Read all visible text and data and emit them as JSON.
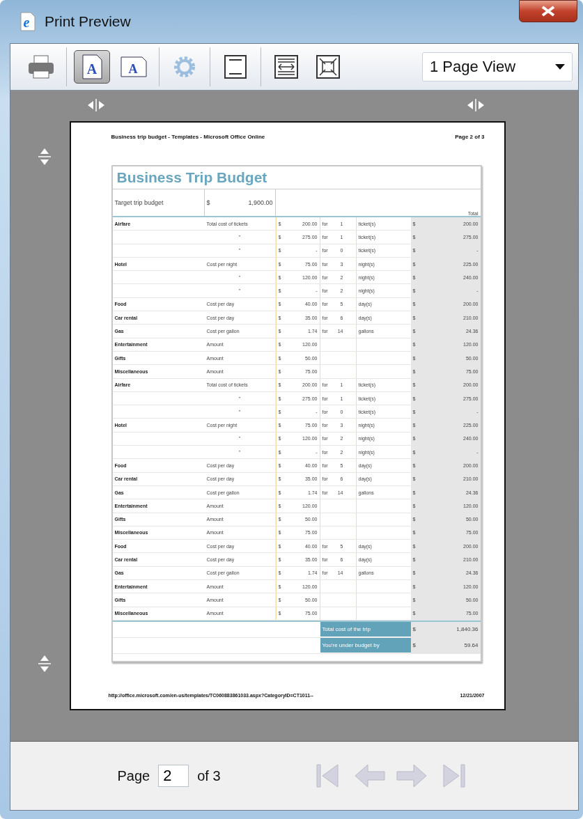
{
  "window": {
    "title": "Print Preview",
    "logo_glyph": "e"
  },
  "toolbar": {
    "buttons": [
      {
        "kind": "print",
        "selected": false,
        "disabled": false
      },
      {
        "kind": "portrait",
        "selected": true,
        "disabled": false,
        "glyph": "A"
      },
      {
        "kind": "landscape",
        "selected": false,
        "disabled": false,
        "glyph": "A"
      },
      {
        "kind": "settings",
        "selected": false,
        "disabled": true
      },
      {
        "kind": "headers",
        "selected": false,
        "disabled": false
      },
      {
        "kind": "fit-width",
        "selected": false,
        "disabled": false
      },
      {
        "kind": "full-page",
        "selected": false,
        "disabled": false
      }
    ],
    "view_select": {
      "value": "1 Page View"
    }
  },
  "page": {
    "header_left": "Business trip budget - Templates - Microsoft Office Online",
    "header_right": "Page 2 of 3",
    "title": "Business Trip Budget",
    "target_label": "Target trip budget",
    "target_currency": "$",
    "target_amount": "1,900.00",
    "total_header": "Total",
    "rows": [
      {
        "category": "Airfare",
        "basis": "Total cost of tickets",
        "cur": "$",
        "amount": "200.00",
        "for": "for",
        "qty": "1",
        "unit": "ticket(s)",
        "total_cur": "$",
        "total": "200.00"
      },
      {
        "basis": "\"",
        "cur": "$",
        "amount": "275.00",
        "for": "for",
        "qty": "1",
        "unit": "ticket(s)",
        "total_cur": "$",
        "total": "275.00"
      },
      {
        "basis": "\"",
        "cur": "$",
        "amount": "-",
        "for": "for",
        "qty": "0",
        "unit": "ticket(s)",
        "total_cur": "$",
        "total": "-"
      },
      {
        "category": "Hotel",
        "basis": "Cost per night",
        "cur": "$",
        "amount": "75.00",
        "for": "for",
        "qty": "3",
        "unit": "night(s)",
        "total_cur": "$",
        "total": "225.00"
      },
      {
        "basis": "\"",
        "cur": "$",
        "amount": "120.00",
        "for": "for",
        "qty": "2",
        "unit": "night(s)",
        "total_cur": "$",
        "total": "240.00"
      },
      {
        "basis": "\"",
        "cur": "$",
        "amount": "-",
        "for": "for",
        "qty": "2",
        "unit": "night(s)",
        "total_cur": "$",
        "total": "-"
      },
      {
        "category": "Food",
        "basis": "Cost per day",
        "cur": "$",
        "amount": "40.00",
        "for": "for",
        "qty": "5",
        "unit": "day(s)",
        "total_cur": "$",
        "total": "200.00"
      },
      {
        "category": "Car rental",
        "basis": "Cost per day",
        "cur": "$",
        "amount": "35.00",
        "for": "for",
        "qty": "6",
        "unit": "day(s)",
        "total_cur": "$",
        "total": "210.00"
      },
      {
        "category": "Gas",
        "basis": "Cost per gallon",
        "cur": "$",
        "amount": "1.74",
        "for": "for",
        "qty": "14",
        "unit": "gallons",
        "total_cur": "$",
        "total": "24.36"
      },
      {
        "category": "Entertainment",
        "basis": "Amount",
        "cur": "$",
        "amount": "120.00",
        "total_cur": "$",
        "total": "120.00"
      },
      {
        "category": "Gifts",
        "basis": "Amount",
        "cur": "$",
        "amount": "50.00",
        "total_cur": "$",
        "total": "50.00"
      },
      {
        "category": "Miscellaneous",
        "basis": "Amount",
        "cur": "$",
        "amount": "75.00",
        "total_cur": "$",
        "total": "75.00"
      },
      {
        "category": "Airfare",
        "basis": "Total cost of tickets",
        "cur": "$",
        "amount": "200.00",
        "for": "for",
        "qty": "1",
        "unit": "ticket(s)",
        "total_cur": "$",
        "total": "200.00"
      },
      {
        "basis": "\"",
        "cur": "$",
        "amount": "275.00",
        "for": "for",
        "qty": "1",
        "unit": "ticket(s)",
        "total_cur": "$",
        "total": "275.00"
      },
      {
        "basis": "\"",
        "cur": "$",
        "amount": "-",
        "for": "for",
        "qty": "0",
        "unit": "ticket(s)",
        "total_cur": "$",
        "total": "-"
      },
      {
        "category": "Hotel",
        "basis": "Cost per night",
        "cur": "$",
        "amount": "75.00",
        "for": "for",
        "qty": "3",
        "unit": "night(s)",
        "total_cur": "$",
        "total": "225.00"
      },
      {
        "basis": "\"",
        "cur": "$",
        "amount": "120.00",
        "for": "for",
        "qty": "2",
        "unit": "night(s)",
        "total_cur": "$",
        "total": "240.00"
      },
      {
        "basis": "\"",
        "cur": "$",
        "amount": "-",
        "for": "for",
        "qty": "2",
        "unit": "night(s)",
        "total_cur": "$",
        "total": "-"
      },
      {
        "category": "Food",
        "basis": "Cost per day",
        "cur": "$",
        "amount": "40.00",
        "for": "for",
        "qty": "5",
        "unit": "day(s)",
        "total_cur": "$",
        "total": "200.00"
      },
      {
        "category": "Car rental",
        "basis": "Cost per day",
        "cur": "$",
        "amount": "35.00",
        "for": "for",
        "qty": "6",
        "unit": "day(s)",
        "total_cur": "$",
        "total": "210.00"
      },
      {
        "category": "Gas",
        "basis": "Cost per gallon",
        "cur": "$",
        "amount": "1.74",
        "for": "for",
        "qty": "14",
        "unit": "gallons",
        "total_cur": "$",
        "total": "24.36"
      },
      {
        "category": "Entertainment",
        "basis": "Amount",
        "cur": "$",
        "amount": "120.00",
        "total_cur": "$",
        "total": "120.00"
      },
      {
        "category": "Gifts",
        "basis": "Amount",
        "cur": "$",
        "amount": "50.00",
        "total_cur": "$",
        "total": "50.00"
      },
      {
        "category": "Miscellaneous",
        "basis": "Amount",
        "cur": "$",
        "amount": "75.00",
        "total_cur": "$",
        "total": "75.00"
      },
      {
        "category": "Food",
        "basis": "Cost per day",
        "cur": "$",
        "amount": "40.00",
        "for": "for",
        "qty": "5",
        "unit": "day(s)",
        "total_cur": "$",
        "total": "200.00"
      },
      {
        "category": "Car rental",
        "basis": "Cost per day",
        "cur": "$",
        "amount": "35.00",
        "for": "for",
        "qty": "6",
        "unit": "day(s)",
        "total_cur": "$",
        "total": "210.00"
      },
      {
        "category": "Gas",
        "basis": "Cost per gallon",
        "cur": "$",
        "amount": "1.74",
        "for": "for",
        "qty": "14",
        "unit": "gallons",
        "total_cur": "$",
        "total": "24.36"
      },
      {
        "category": "Entertainment",
        "basis": "Amount",
        "cur": "$",
        "amount": "120.00",
        "total_cur": "$",
        "total": "120.00"
      },
      {
        "category": "Gifts",
        "basis": "Amount",
        "cur": "$",
        "amount": "50.00",
        "total_cur": "$",
        "total": "50.00"
      },
      {
        "category": "Miscellaneous",
        "basis": "Amount",
        "cur": "$",
        "amount": "75.00",
        "total_cur": "$",
        "total": "75.00"
      }
    ],
    "summary": [
      {
        "label": "Total cost of the trip",
        "cur": "$",
        "value": "1,840.36"
      },
      {
        "label": "You're under budget by",
        "cur": "$",
        "value": "59.64"
      }
    ],
    "footer_url": "http://office.microsoft.com/en-us/templates/TC060883861033.aspx?CategoryID=CT1011--",
    "footer_date": "12/21/2007"
  },
  "pagination": {
    "label": "Page",
    "value": "2",
    "of": "of 3",
    "buttons": [
      {
        "kind": "first",
        "disabled": true
      },
      {
        "kind": "previous",
        "disabled": true
      },
      {
        "kind": "next",
        "disabled": true
      },
      {
        "kind": "last",
        "disabled": true
      }
    ]
  }
}
